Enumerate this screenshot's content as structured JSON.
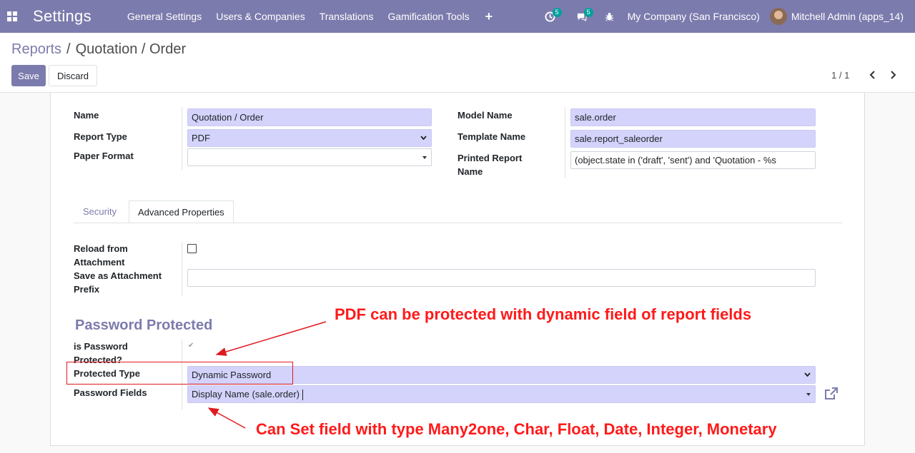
{
  "navbar": {
    "app_title": "Settings",
    "menu": [
      "General Settings",
      "Users & Companies",
      "Translations",
      "Gamification Tools"
    ],
    "plus": "+",
    "activity_count": "5",
    "messages_count": "5",
    "company": "My Company (San Francisco)",
    "user": "Mitchell Admin (apps_14)"
  },
  "breadcrumb": {
    "parent": "Reports",
    "sep1": "/",
    "sep2": "/",
    "current": "Quotation / Order"
  },
  "buttons": {
    "save": "Save",
    "discard": "Discard"
  },
  "pager": {
    "value": "1 / 1"
  },
  "form": {
    "name_label": "Name",
    "name_value": "Quotation / Order",
    "report_type_label": "Report Type",
    "report_type_value": "PDF",
    "paper_format_label": "Paper Format",
    "paper_format_value": "",
    "model_name_label": "Model Name",
    "model_name_value": "sale.order",
    "template_name_label": "Template Name",
    "template_name_value": "sale.report_saleorder",
    "printed_name_label_1": "Printed Report",
    "printed_name_label_2": "Name",
    "printed_name_value": "(object.state in ('draft', 'sent') and 'Quotation - %s"
  },
  "tabs": {
    "security": "Security",
    "advanced": "Advanced Properties"
  },
  "advanced": {
    "reload_label_1": "Reload from",
    "reload_label_2": "Attachment",
    "reload_checked": false,
    "prefix_label_1": "Save as Attachment",
    "prefix_label_2": "Prefix",
    "prefix_value": ""
  },
  "password": {
    "section_title": "Password Protected",
    "is_protected_label_1": "is Password",
    "is_protected_label_2": "Protected?",
    "protected_type_label": "Protected Type",
    "protected_type_value": "Dynamic Password",
    "password_fields_label": "Password Fields",
    "password_fields_value": "Display Name (sale.order)"
  },
  "annotations": {
    "top": "PDF can be protected with dynamic field of report fields",
    "bottom": "Can Set field with type Many2one, Char, Float, Date, Integer, Monetary",
    "color": "#ff1a1a"
  },
  "colors": {
    "primary": "#7c7bad",
    "field_bg": "#d3d3fb",
    "badge": "#00a09d"
  }
}
